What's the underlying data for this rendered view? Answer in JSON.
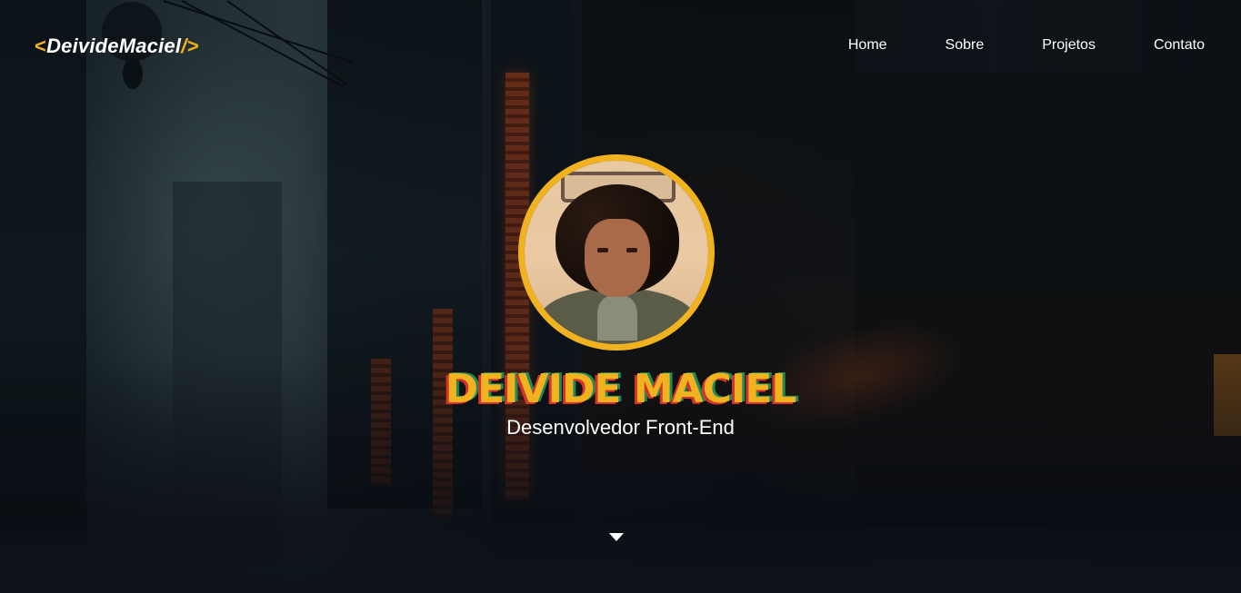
{
  "logo": {
    "open": "<",
    "name": "DeivideMaciel",
    "close": "/>"
  },
  "nav": {
    "items": [
      {
        "label": "Home"
      },
      {
        "label": "Sobre"
      },
      {
        "label": "Projetos"
      },
      {
        "label": "Contato"
      }
    ]
  },
  "hero": {
    "title": "DEIVIDE MACIEL",
    "subtitle": "Desenvolvedor Front-End",
    "scroll_icon": "caret-down-icon"
  },
  "colors": {
    "accent": "#f0b21e",
    "text": "#ffffff",
    "shadow_red": "#d4322c",
    "shadow_green": "#1f8a5a"
  }
}
